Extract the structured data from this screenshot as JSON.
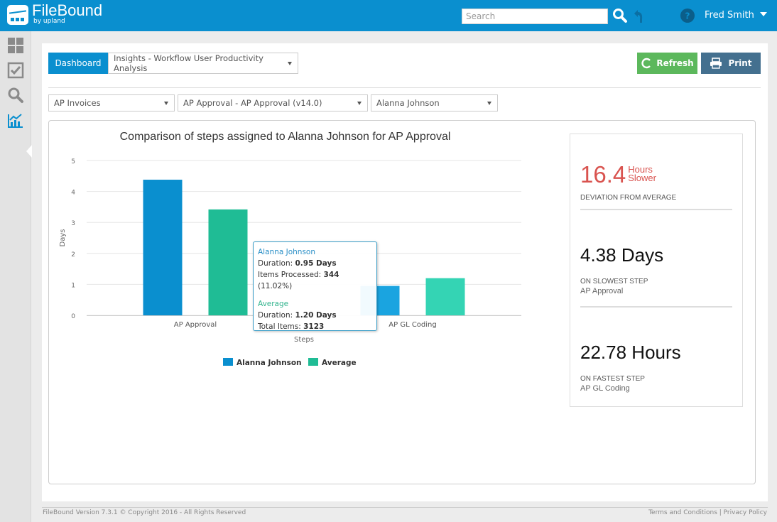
{
  "app": {
    "brand": "FileBound",
    "brand_sub": "by upland"
  },
  "header": {
    "search_placeholder": "Search",
    "search_value": "",
    "user_name": "Fred Smith",
    "icons": [
      "search-icon",
      "undo-icon",
      "help-icon",
      "caret-down-icon"
    ]
  },
  "sidebar": {
    "items": [
      {
        "name": "dashboard",
        "icon": "grid-icon"
      },
      {
        "name": "tasks",
        "icon": "checkbox-icon"
      },
      {
        "name": "search",
        "icon": "search-icon"
      },
      {
        "name": "insights",
        "icon": "chart-icon",
        "active": true
      }
    ]
  },
  "toolbar": {
    "dashboard_label": "Dashboard",
    "report_select": "Insights - Workflow User Productivity Analysis",
    "refresh_label": "Refresh",
    "print_label": "Print"
  },
  "filters": {
    "project": "AP Invoices",
    "workflow": "AP Approval - AP Approval (v14.0)",
    "user": "Alanna Johnson"
  },
  "colors": {
    "brand": "#0a8fcf",
    "series_user": "#0a8fcf",
    "series_avg": "#1fbc95",
    "highlight_red": "#d9534f",
    "refresh": "#5cb85c",
    "print": "#44708f"
  },
  "chart_data": {
    "type": "bar",
    "title": "Comparison of steps assigned to Alanna Johnson for AP Approval",
    "xlabel": "Steps",
    "ylabel": "Days",
    "categories": [
      "AP Approval",
      "AP GL Coding"
    ],
    "series": [
      {
        "name": "Alanna Johnson",
        "values": [
          4.38,
          0.95
        ]
      },
      {
        "name": "Average",
        "values": [
          3.42,
          1.2
        ]
      }
    ],
    "ylim": [
      0,
      5
    ],
    "yticks": [
      "0",
      "1",
      "2",
      "3",
      "4",
      "5"
    ],
    "grid": true,
    "legend": "bottom-center"
  },
  "tooltip": {
    "user_name": "Alanna Johnson",
    "user_duration_label": "Duration: ",
    "user_duration": "0.95 Days",
    "items_label": "Items Processed: ",
    "items_value": "344",
    "items_pct": " (11.02%)",
    "avg_name": "Average",
    "avg_duration_label": "Duration: ",
    "avg_duration": "1.20 Days",
    "total_label": "Total Items: ",
    "total_value": "3123"
  },
  "stats": {
    "deviation_value": "16.4",
    "deviation_unit_1": "Hours",
    "deviation_unit_2": "Slower",
    "deviation_label": "Deviation from average",
    "slowest_value": "4.38 Days",
    "slowest_label": "On slowest step",
    "slowest_step": "AP Approval",
    "fastest_value": "22.78 Hours",
    "fastest_label": "On fastest step",
    "fastest_step": "AP GL Coding"
  },
  "footer": {
    "copyright": "FileBound Version 7.3.1 © Copyright 2016 - All Rights Reserved",
    "terms": "Terms and Conditions",
    "separator": " | ",
    "privacy": "Privacy Policy"
  }
}
